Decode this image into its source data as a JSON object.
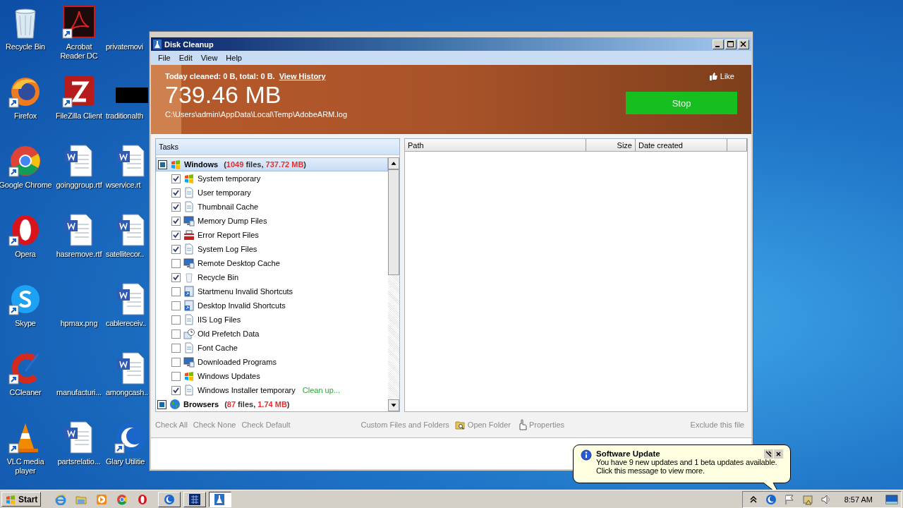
{
  "desktop": {
    "icons": [
      {
        "label": "Recycle Bin",
        "kind": "recycle",
        "shortcut": false
      },
      {
        "label": "Firefox",
        "kind": "firefox",
        "shortcut": true
      },
      {
        "label": "Google Chrome",
        "kind": "chrome",
        "shortcut": true
      },
      {
        "label": "Opera",
        "kind": "opera",
        "shortcut": true
      },
      {
        "label": "Skype",
        "kind": "skype",
        "shortcut": true
      },
      {
        "label": "CCleaner",
        "kind": "ccleaner",
        "shortcut": true
      },
      {
        "label": "VLC media player",
        "kind": "vlc",
        "shortcut": true
      },
      {
        "label": "Acrobat Reader DC",
        "kind": "acrobat",
        "shortcut": true
      },
      {
        "label": "FileZilla Client",
        "kind": "filezilla",
        "shortcut": true
      },
      {
        "label": "goinggroup.rtf",
        "kind": "word",
        "shortcut": false
      },
      {
        "label": "hasremove.rtf",
        "kind": "word",
        "shortcut": false
      },
      {
        "label": "hpmax.png",
        "kind": "blank"
      },
      {
        "label": "manufacturi...",
        "kind": "blank"
      },
      {
        "label": "partsrelatio...",
        "kind": "word",
        "shortcut": false
      },
      {
        "label": "privatemovi",
        "kind": "blank"
      },
      {
        "label": "traditionalth",
        "kind": "black",
        "shortcut": false
      },
      {
        "label": "wservice.rt",
        "kind": "word",
        "shortcut": false
      },
      {
        "label": "satellitecor..",
        "kind": "word",
        "shortcut": false
      },
      {
        "label": "cablereceiv..",
        "kind": "word",
        "shortcut": false
      },
      {
        "label": "amongcash..",
        "kind": "word",
        "shortcut": false
      },
      {
        "label": "Glary Utilitie",
        "kind": "glary",
        "shortcut": true
      }
    ]
  },
  "window": {
    "title": "Disk Cleanup",
    "menu": [
      "File",
      "Edit",
      "View",
      "Help"
    ],
    "header": {
      "today": "Today cleaned: 0 B, total: 0 B.",
      "history_link": "View History",
      "size": "739.46 MB",
      "path": "C:\\Users\\admin\\AppData\\Local\\Temp\\AdobeARM.log",
      "like": "Like",
      "stop_button": "Stop",
      "progress": {
        "level": 0.05
      }
    },
    "tasks": {
      "title": "Tasks",
      "groups": [
        {
          "name": "Windows",
          "kind": "windows",
          "partial": true,
          "selected": true,
          "summary": [
            {
              "text": "(",
              "kind": "plain"
            },
            {
              "text": "1049",
              "kind": "value"
            },
            {
              "text": " files, ",
              "kind": "plain"
            },
            {
              "text": "737.72 MB",
              "kind": "value"
            },
            {
              "text": ")",
              "kind": "plain"
            }
          ],
          "children": [
            {
              "label": "System temporary",
              "kind": "windows",
              "checked": true
            },
            {
              "label": "User temporary",
              "kind": "file",
              "checked": true
            },
            {
              "label": "Thumbnail Cache",
              "kind": "file",
              "checked": true
            },
            {
              "label": "Memory Dump Files",
              "kind": "monitor",
              "checked": true
            },
            {
              "label": "Error Report Files",
              "kind": "toolbox",
              "checked": true
            },
            {
              "label": "System Log Files",
              "kind": "file",
              "checked": true
            },
            {
              "label": "Remote Desktop Cache",
              "kind": "monitor",
              "checked": false
            },
            {
              "label": "Recycle Bin",
              "kind": "bin",
              "checked": true
            },
            {
              "label": "Startmenu Invalid Shortcuts",
              "kind": "shortcut",
              "checked": false
            },
            {
              "label": "Desktop Invalid Shortcuts",
              "kind": "shortcut",
              "checked": false
            },
            {
              "label": "IIS Log Files",
              "kind": "file",
              "checked": false
            },
            {
              "label": "Old Prefetch Data",
              "kind": "clock",
              "checked": false
            },
            {
              "label": "Font Cache",
              "kind": "file",
              "checked": false
            },
            {
              "label": "Downloaded Programs",
              "kind": "monitor",
              "checked": false
            },
            {
              "label": "Windows Updates",
              "kind": "windows",
              "checked": false
            },
            {
              "label": "Windows Installer temporary",
              "kind": "file",
              "checked": true,
              "note": "Clean up..."
            }
          ]
        },
        {
          "name": "Browsers",
          "kind": "globe",
          "partial": true,
          "selected": false,
          "summary": [
            {
              "text": "(",
              "kind": "plain"
            },
            {
              "text": "87",
              "kind": "value"
            },
            {
              "text": " files, ",
              "kind": "plain"
            },
            {
              "text": "1.74 MB",
              "kind": "value"
            },
            {
              "text": ")",
              "kind": "plain"
            }
          ]
        }
      ]
    },
    "files": {
      "columns": [
        "Path",
        "Size",
        "Date created"
      ]
    },
    "footer": {
      "left": [
        {
          "label": "Check All",
          "kind": "text",
          "disabled": true
        },
        {
          "label": "Check None",
          "kind": "text",
          "disabled": true
        },
        {
          "label": "Check Default",
          "kind": "text",
          "disabled": true
        }
      ],
      "middle": [
        {
          "label": "Custom Files and Folders",
          "kind": "text",
          "disabled": true
        },
        {
          "label": "Open Folder",
          "kind": "folder",
          "disabled": true
        },
        {
          "label": "Properties",
          "kind": "hand",
          "disabled": true
        }
      ],
      "right": [
        {
          "label": "Exclude this file",
          "kind": "text",
          "disabled": true
        }
      ]
    }
  },
  "balloon": {
    "title": "Software Update",
    "message": [
      "You have 9 new updates and 1 beta updates available.",
      "Click this message to view more."
    ]
  },
  "taskbar": {
    "start": "Start",
    "tasks": [
      {
        "kind": "glary",
        "selected": false
      },
      {
        "kind": "grid",
        "selected": false
      },
      {
        "kind": "cleanup",
        "selected": true
      }
    ],
    "clock": "8:57 AM"
  }
}
